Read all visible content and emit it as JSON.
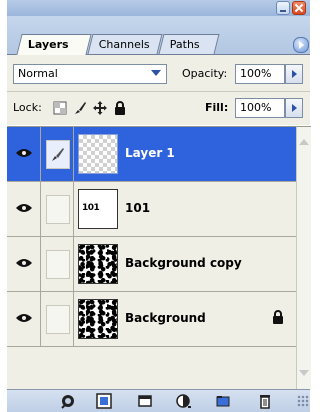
{
  "window": {
    "buttons": [
      "minimize",
      "close"
    ]
  },
  "tabs": [
    {
      "label": "Layers",
      "active": true
    },
    {
      "label": "Channels",
      "active": false
    },
    {
      "label": "Paths",
      "active": false
    }
  ],
  "blend": {
    "mode": "Normal",
    "opacity_label": "Opacity:",
    "opacity_value": "100%"
  },
  "lock": {
    "label": "Lock:",
    "fill_label": "Fill:",
    "fill_value": "100%",
    "icons": [
      "lock-transparent-pixels-icon",
      "lock-image-pixels-icon",
      "lock-position-icon",
      "lock-all-icon"
    ]
  },
  "layers": [
    {
      "name": "Layer 1",
      "selected": true,
      "visible": true,
      "thumb": "transparent-checker",
      "link": "brush-icon"
    },
    {
      "name": "101",
      "selected": false,
      "visible": true,
      "thumb": "text"
    },
    {
      "name": "Background copy",
      "selected": false,
      "visible": true,
      "thumb": "noise"
    },
    {
      "name": "Background",
      "selected": false,
      "visible": true,
      "thumb": "noise",
      "locked": true
    }
  ],
  "thumb_text": "101",
  "toolbar": {
    "icons": [
      "link-layers-icon",
      "add-layer-style-icon",
      "add-mask-icon",
      "new-fill-adjustment-icon",
      "new-group-icon",
      "new-layer-icon",
      "delete-layer-icon"
    ]
  },
  "colors": {
    "selection": "#2f63de",
    "panel_bg": "#efefe6",
    "tab_bar": "#b3c7e3"
  }
}
